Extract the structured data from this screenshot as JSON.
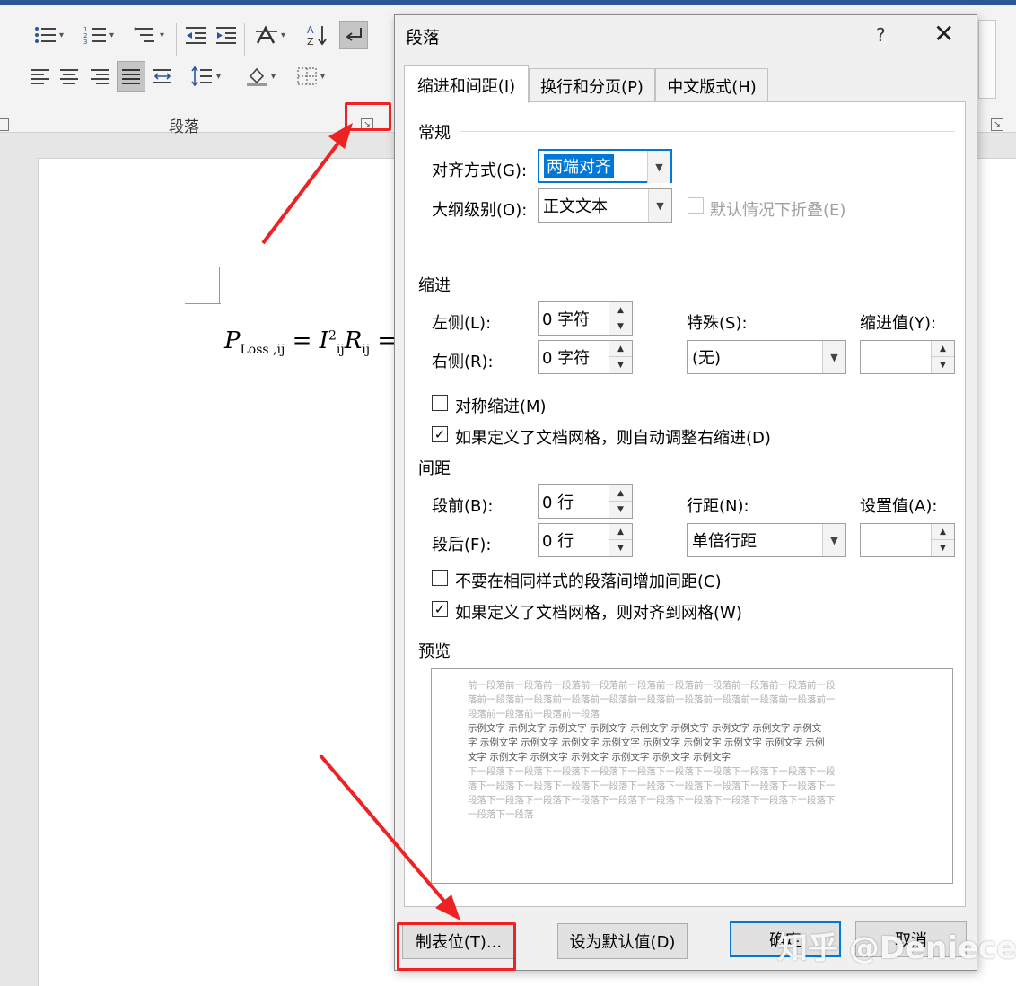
{
  "ribbon": {
    "group_label": "段落",
    "launcher_glyph": "↘",
    "icons": [
      "bullets-icon",
      "numbering-icon",
      "multilevel-list-icon",
      "decrease-indent-icon",
      "increase-indent-icon",
      "chinese-layout-icon",
      "sort-icon",
      "show-marks-icon",
      "align-left-icon",
      "align-center-icon",
      "align-right-icon",
      "justify-icon",
      "distributed-icon",
      "line-spacing-icon",
      "shading-icon",
      "borders-icon"
    ]
  },
  "document": {
    "formula": {
      "p": "P",
      "p_sub": "Loss ,ij",
      "eq1": " = ",
      "i": "I",
      "i_sup": "2",
      "i_sub": "ij",
      "r": "R",
      "r_sub": "ij",
      "eq2": " = ",
      "paren": "("
    }
  },
  "dialog": {
    "title": "段落",
    "help": "?",
    "close": "✕",
    "tabs": [
      {
        "label": "缩进和间距(I)",
        "active": true
      },
      {
        "label": "换行和分页(P)",
        "active": false
      },
      {
        "label": "中文版式(H)",
        "active": false
      }
    ],
    "general": {
      "heading": "常规",
      "alignment_label": "对齐方式(G):",
      "alignment_value": "两端对齐",
      "outline_label": "大纲级别(O):",
      "outline_value": "正文文本",
      "collapse_label": "默认情况下折叠(E)"
    },
    "indent": {
      "heading": "缩进",
      "left_label": "左侧(L):",
      "left_value": "0 字符",
      "right_label": "右侧(R):",
      "right_value": "0 字符",
      "special_label": "特殊(S):",
      "special_value": "(无)",
      "by_label": "缩进值(Y):",
      "by_value": "",
      "mirror_label": "对称缩进(M)",
      "mirror_checked": false,
      "auto_right_label": "如果定义了文档网格，则自动调整右缩进(D)",
      "auto_right_checked": true
    },
    "spacing": {
      "heading": "间距",
      "before_label": "段前(B):",
      "before_value": "0 行",
      "after_label": "段后(F):",
      "after_value": "0 行",
      "line_label": "行距(N):",
      "line_value": "单倍行距",
      "at_label": "设置值(A):",
      "at_value": "",
      "no_space_label": "不要在相同样式的段落间增加间距(C)",
      "no_space_checked": false,
      "snap_label": "如果定义了文档网格，则对齐到网格(W)",
      "snap_checked": true
    },
    "preview": {
      "heading": "预览",
      "before_lines": [
        "前一段落前一段落前一段落前一段落前一段落前一段落前一段落前一段落前一段落前一段",
        "落前一段落前一段落前一段落前一段落前一段落前一段落前一段落前一段落前一段落前一",
        "段落前一段落前一段落前一段落"
      ],
      "sample_lines": [
        "示例文字  示例文字  示例文字  示例文字  示例文字  示例文字  示例文字  示例文字  示例文",
        "字  示例文字  示例文字  示例文字  示例文字  示例文字  示例文字  示例文字  示例文字  示例",
        "文字  示例文字  示例文字  示例文字  示例文字  示例文字  示例文字"
      ],
      "after_lines": [
        "下一段落下一段落下一段落下一段落下一段落下一段落下一段落下一段落下一段落下一段",
        "落下一段落下一段落下一段落下一段落下一段落下一段落下一段落下一段落下一段落下一",
        "段落下一段落下一段落下一段落下一段落下一段落下一段落下一段落下一段落下一段落下",
        "一段落下一段落"
      ]
    },
    "buttons": {
      "tabs": "制表位(T)...",
      "set_default": "设为默认值(D)",
      "ok": "确定",
      "cancel": "取消"
    }
  },
  "watermark": "知乎 @Deniece",
  "colors": {
    "annotation": "#ee2222",
    "accent": "#0078d7",
    "title_bar": "#2b579a"
  }
}
